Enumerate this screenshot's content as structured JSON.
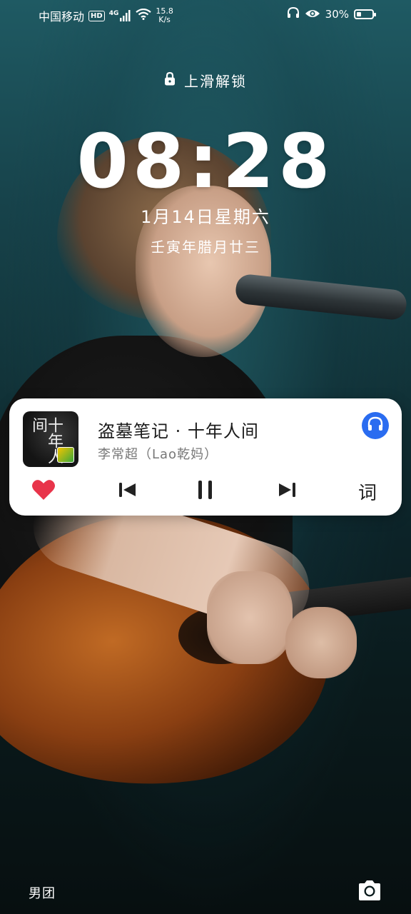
{
  "status_bar": {
    "carrier": "中国移动",
    "hd_badge": "HD",
    "network": "4G",
    "speed_value": "15.8",
    "speed_unit": "K/s",
    "battery_text": "30%",
    "battery_level": 0.3
  },
  "lock": {
    "unlock_hint": "上滑解锁",
    "time": "08:28",
    "date": "1月14日星期六",
    "lunar_date": "壬寅年腊月廿三"
  },
  "music_card": {
    "cover_text": "十年人间",
    "title": "盗墓笔记 · 十年人间",
    "artist": "李常超（Lao乾妈）",
    "lyric_button": "词",
    "liked": true,
    "playing": true,
    "accent_color": "#2a6cf0",
    "like_color": "#e8344a"
  },
  "bottom": {
    "left_label": "男团"
  },
  "icons": [
    "signal-icon",
    "wifi-icon",
    "headphones-icon",
    "eye-icon",
    "battery-icon",
    "lock-icon",
    "heart-icon",
    "previous-icon",
    "pause-icon",
    "next-icon",
    "camera-icon"
  ]
}
